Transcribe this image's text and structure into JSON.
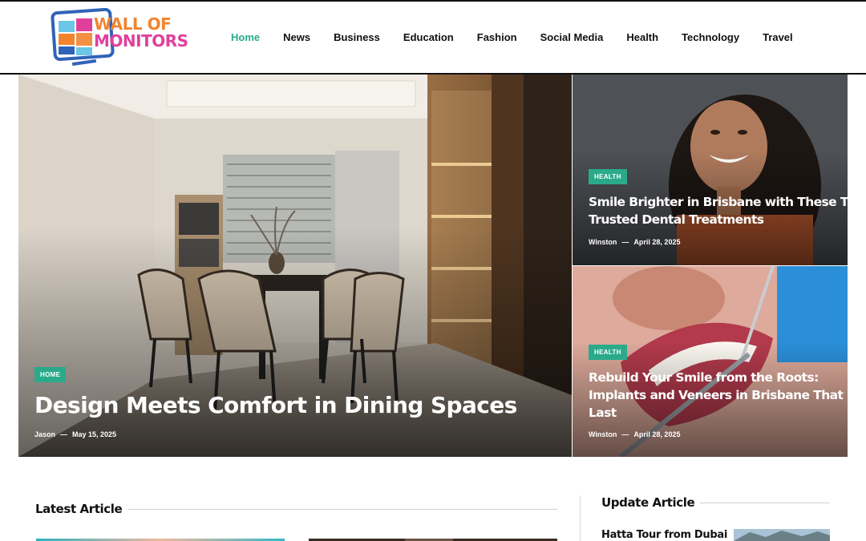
{
  "brand": {
    "line1": "WALL OF",
    "line2": "MONITORS",
    "colors": {
      "orange": "#f2842f",
      "pink": "#e0409c",
      "blue": "#2f63b8",
      "accent": "#2aaa8a"
    }
  },
  "nav": {
    "items": [
      {
        "label": "Home",
        "active": true
      },
      {
        "label": "News"
      },
      {
        "label": "Business"
      },
      {
        "label": "Education"
      },
      {
        "label": "Fashion"
      },
      {
        "label": "Social Media"
      },
      {
        "label": "Health"
      },
      {
        "label": "Technology"
      },
      {
        "label": "Travel"
      }
    ]
  },
  "hero": {
    "main": {
      "category": "HOME",
      "title": "Design Meets Comfort in Dining Spaces",
      "author": "Jason",
      "sep": "—",
      "date": "May 15, 2025"
    },
    "side": [
      {
        "category": "HEALTH",
        "title_line1": "Smile Brighter in Brisbane with These Two",
        "title_line2": "Trusted Dental Treatments",
        "author": "Winston",
        "sep": "—",
        "date": "April 28, 2025"
      },
      {
        "category": "HEALTH",
        "title_line1": "Rebuild Your Smile from the Roots:",
        "title_line2": "Implants and Veneers in Brisbane That",
        "title_line3": "Last",
        "author": "Winston",
        "sep": "—",
        "date": "April 28, 2025"
      }
    ]
  },
  "sections": {
    "latest": {
      "title": "Latest Article"
    },
    "update": {
      "title": "Update Article",
      "first_item": "Hatta Tour from Dubai"
    }
  }
}
